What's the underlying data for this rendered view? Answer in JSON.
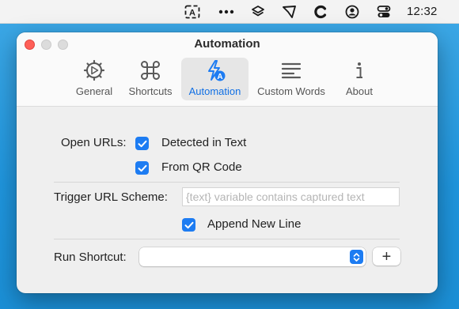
{
  "menubar": {
    "icons": [
      "text-recognition-icon",
      "more-icon",
      "layers-icon",
      "snip-icon",
      "c-app-icon",
      "user-icon",
      "control-center-icon"
    ],
    "clock": "12:32"
  },
  "window": {
    "title": "Automation",
    "tabs": [
      {
        "label": "General",
        "icon": "gear-icon",
        "active": false
      },
      {
        "label": "Shortcuts",
        "icon": "command-icon",
        "active": false
      },
      {
        "label": "Automation",
        "icon": "automation-icon",
        "active": true
      },
      {
        "label": "Custom Words",
        "icon": "text-lines-icon",
        "active": false
      },
      {
        "label": "About",
        "icon": "info-icon",
        "active": false
      }
    ]
  },
  "settings": {
    "open_urls_label": "Open URLs:",
    "detected_in_text_label": "Detected in Text",
    "detected_in_text_checked": true,
    "from_qr_code_label": "From QR Code",
    "from_qr_code_checked": true,
    "trigger_url_scheme_label": "Trigger URL Scheme:",
    "trigger_url_scheme_value": "",
    "trigger_url_scheme_placeholder": "{text} variable contains captured text",
    "append_new_line_label": "Append New Line",
    "append_new_line_checked": true,
    "run_shortcut_label": "Run Shortcut:",
    "run_shortcut_value": "",
    "add_button_label": "+"
  },
  "colors": {
    "accent": "#1d7cf2",
    "active_tab_label": "#1170e4",
    "desktop": "#1f95dd"
  }
}
